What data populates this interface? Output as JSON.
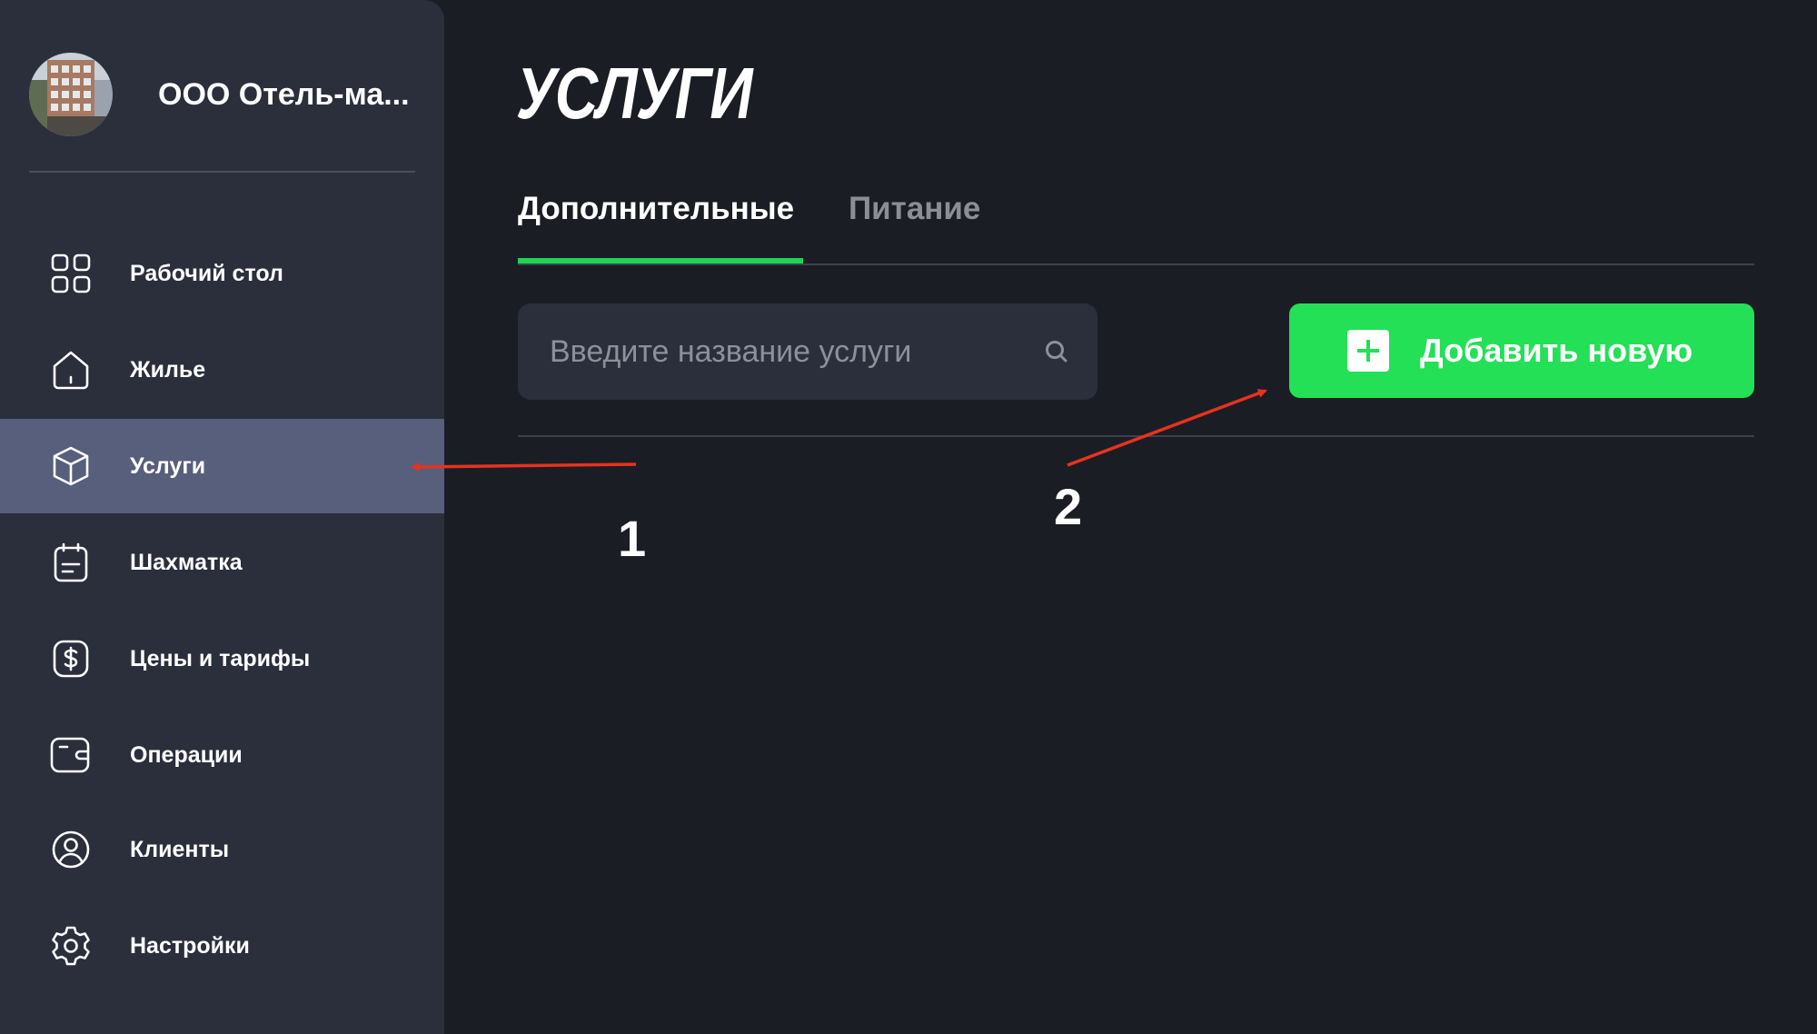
{
  "sidebar": {
    "org_name": "ООО Отель-ма...",
    "items": [
      {
        "label": "Рабочий стол",
        "icon": "dashboard-grid-icon",
        "active": false
      },
      {
        "label": "Жилье",
        "icon": "home-icon",
        "active": false
      },
      {
        "label": "Услуги",
        "icon": "box-icon",
        "active": true
      },
      {
        "label": "Шахматка",
        "icon": "calendar-icon",
        "active": false
      },
      {
        "label": "Цены и тарифы",
        "icon": "dollar-icon",
        "active": false
      },
      {
        "label": "Операции",
        "icon": "wallet-icon",
        "active": false
      },
      {
        "label": "Клиенты",
        "icon": "user-icon",
        "active": false
      },
      {
        "label": "Настройки",
        "icon": "gear-icon",
        "active": false
      }
    ]
  },
  "main": {
    "title": "УСЛУГИ",
    "tabs": [
      {
        "label": "Дополнительные",
        "active": true
      },
      {
        "label": "Питание",
        "active": false
      }
    ],
    "search": {
      "placeholder": "Введите название услуги",
      "value": ""
    },
    "add_button": {
      "label": "Добавить новую"
    }
  },
  "annotations": {
    "callout_1": "1",
    "callout_2": "2"
  },
  "colors": {
    "background": "#1b1d25",
    "sidebar": "#2b2e3b",
    "active_item": "#585f7c",
    "accent_green": "#23e057",
    "tab_underline": "#1fd355",
    "annotation_arrow": "#e8321e"
  }
}
